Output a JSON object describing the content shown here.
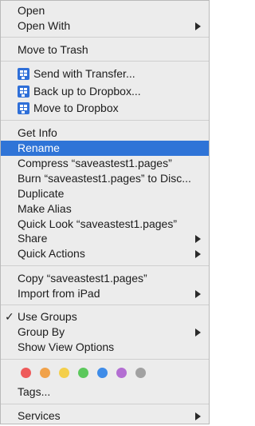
{
  "menu": {
    "open": "Open",
    "open_with": "Open With",
    "move_to_trash": "Move to Trash",
    "send_with_transfer": "Send with Transfer...",
    "back_up_dropbox": "Back up to Dropbox...",
    "move_to_dropbox": "Move to Dropbox",
    "get_info": "Get Info",
    "rename": "Rename",
    "compress": "Compress “saveastest1.pages”",
    "burn": "Burn “saveastest1.pages” to Disc...",
    "duplicate": "Duplicate",
    "make_alias": "Make Alias",
    "quick_look": "Quick Look “saveastest1.pages”",
    "share": "Share",
    "quick_actions": "Quick Actions",
    "copy": "Copy “saveastest1.pages”",
    "import_from_ipad": "Import from iPad",
    "use_groups": "Use Groups",
    "group_by": "Group By",
    "show_view_options": "Show View Options",
    "tags": "Tags...",
    "services": "Services",
    "checkmark": "✓"
  },
  "tag_colors": [
    "#ee5a5a",
    "#f1a24a",
    "#f4cf4b",
    "#5cc85c",
    "#3f8ce8",
    "#b36ed2",
    "#a1a1a1"
  ],
  "icons": {
    "dropbox": "dropbox-icon",
    "submenu": "submenu-arrow-icon",
    "check": "checkmark-icon"
  }
}
